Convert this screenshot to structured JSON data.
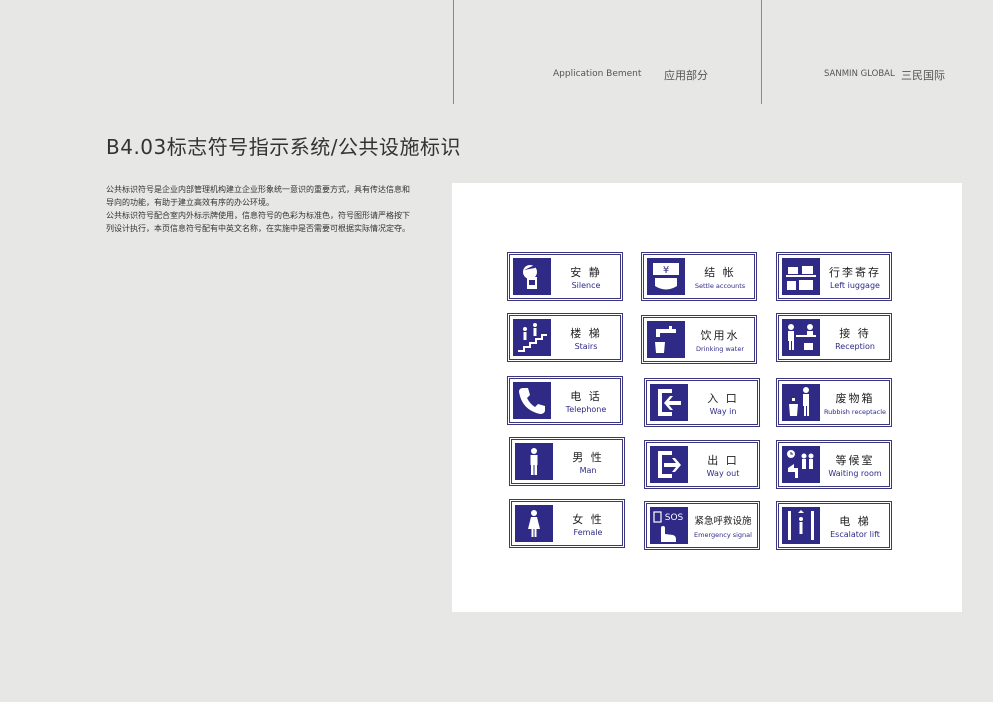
{
  "header": {
    "section_en": "Application Bement",
    "section_cn": "应用部分",
    "brand_en": "SANMIN GLOBAL",
    "brand_cn": "三民国际"
  },
  "page_title": "B4.03标志符号指示系统/公共设施标识",
  "description": [
    "公共标识符号是企业内部管理机构建立企业形象统一意识的重要方式，具有传达信息和导向的功能，有助于建立高效有序的办公环境。",
    "公共标识符号配合室内外标示牌使用，信息符号的色彩为标准色，符号图形请严格按下列设计执行，本页信息符号配有中英文名称，在实施中是否需要可根据实际情况定夺。"
  ],
  "colors": {
    "sign_blue": "#2e2a86",
    "page_bg": "#e7e7e5",
    "panel_bg": "#ffffff"
  },
  "signs": [
    {
      "cn": "安 静",
      "en": "Silence",
      "icon": "silence-icon"
    },
    {
      "cn": "结 帐",
      "en": "Settle accounts",
      "icon": "yen-cashier-icon"
    },
    {
      "cn": "行李寄存",
      "en": "Left iuggage",
      "icon": "luggage-icon"
    },
    {
      "cn": "楼 梯",
      "en": "Stairs",
      "icon": "stairs-icon"
    },
    {
      "cn": "饮用水",
      "en": "Drinking water",
      "icon": "faucet-icon"
    },
    {
      "cn": "接 待",
      "en": "Reception",
      "icon": "reception-icon"
    },
    {
      "cn": "电 话",
      "en": "Telephone",
      "icon": "telephone-icon"
    },
    {
      "cn": "入 口",
      "en": "Way in",
      "icon": "entrance-icon"
    },
    {
      "cn": "废物箱",
      "en": "Rubbish receptacle",
      "icon": "rubbish-bin-icon"
    },
    {
      "cn": "男 性",
      "en": "Man",
      "icon": "man-icon"
    },
    {
      "cn": "出 口",
      "en": "Way out",
      "icon": "exit-icon"
    },
    {
      "cn": "等候室",
      "en": "Waiting room",
      "icon": "waiting-room-icon"
    },
    {
      "cn": "女 性",
      "en": "Female",
      "icon": "woman-icon"
    },
    {
      "cn": "紧急呼救设施",
      "en": "Emergency signal",
      "icon": "sos-button-icon"
    },
    {
      "cn": "电 梯",
      "en": "Escalator lift",
      "icon": "elevator-icon"
    }
  ]
}
